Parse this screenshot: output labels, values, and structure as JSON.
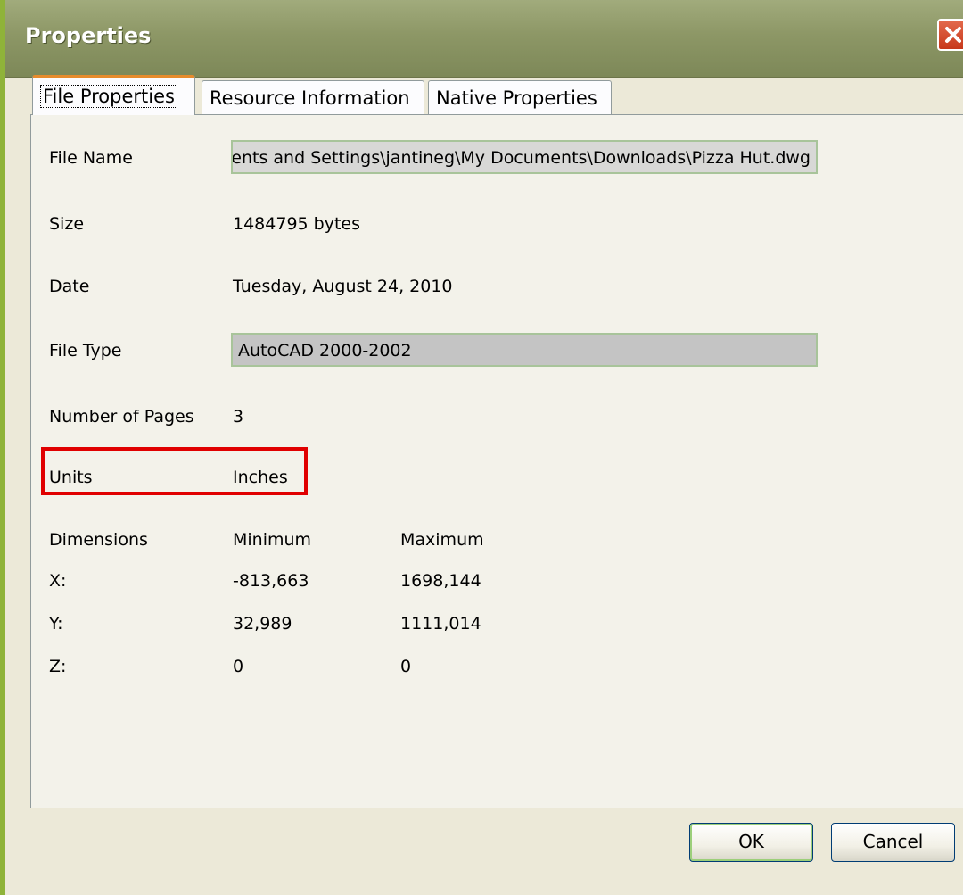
{
  "window": {
    "title": "Properties"
  },
  "tabs": [
    {
      "label": "File Properties"
    },
    {
      "label": "Resource Information"
    },
    {
      "label": "Native Properties"
    }
  ],
  "file_properties": {
    "file_name_label": "File Name",
    "file_name_value": "C:\\Documents and Settings\\jantineg\\My Documents\\Downloads\\Pizza Hut.dwg",
    "size_label": "Size",
    "size_value": "1484795 bytes",
    "date_label": "Date",
    "date_value": "Tuesday, August 24, 2010",
    "file_type_label": "File Type",
    "file_type_value": "AutoCAD 2000-2002",
    "pages_label": "Number of Pages",
    "pages_value": "3",
    "units_label": "Units",
    "units_value": "Inches"
  },
  "dimensions": {
    "label": "Dimensions",
    "min_header": "Minimum",
    "max_header": "Maximum",
    "rows": [
      {
        "axis": "X:",
        "min": "-813,663",
        "max": "1698,144"
      },
      {
        "axis": "Y:",
        "min": "32,989",
        "max": "1111,014"
      },
      {
        "axis": "Z:",
        "min": "0",
        "max": "0"
      }
    ]
  },
  "buttons": {
    "ok": "OK",
    "cancel": "Cancel"
  },
  "colors": {
    "highlight": "#e00000",
    "titlebar": "#8d9766",
    "active_tab_accent": "#e68b2c"
  },
  "icons": {
    "close": "close-icon"
  }
}
